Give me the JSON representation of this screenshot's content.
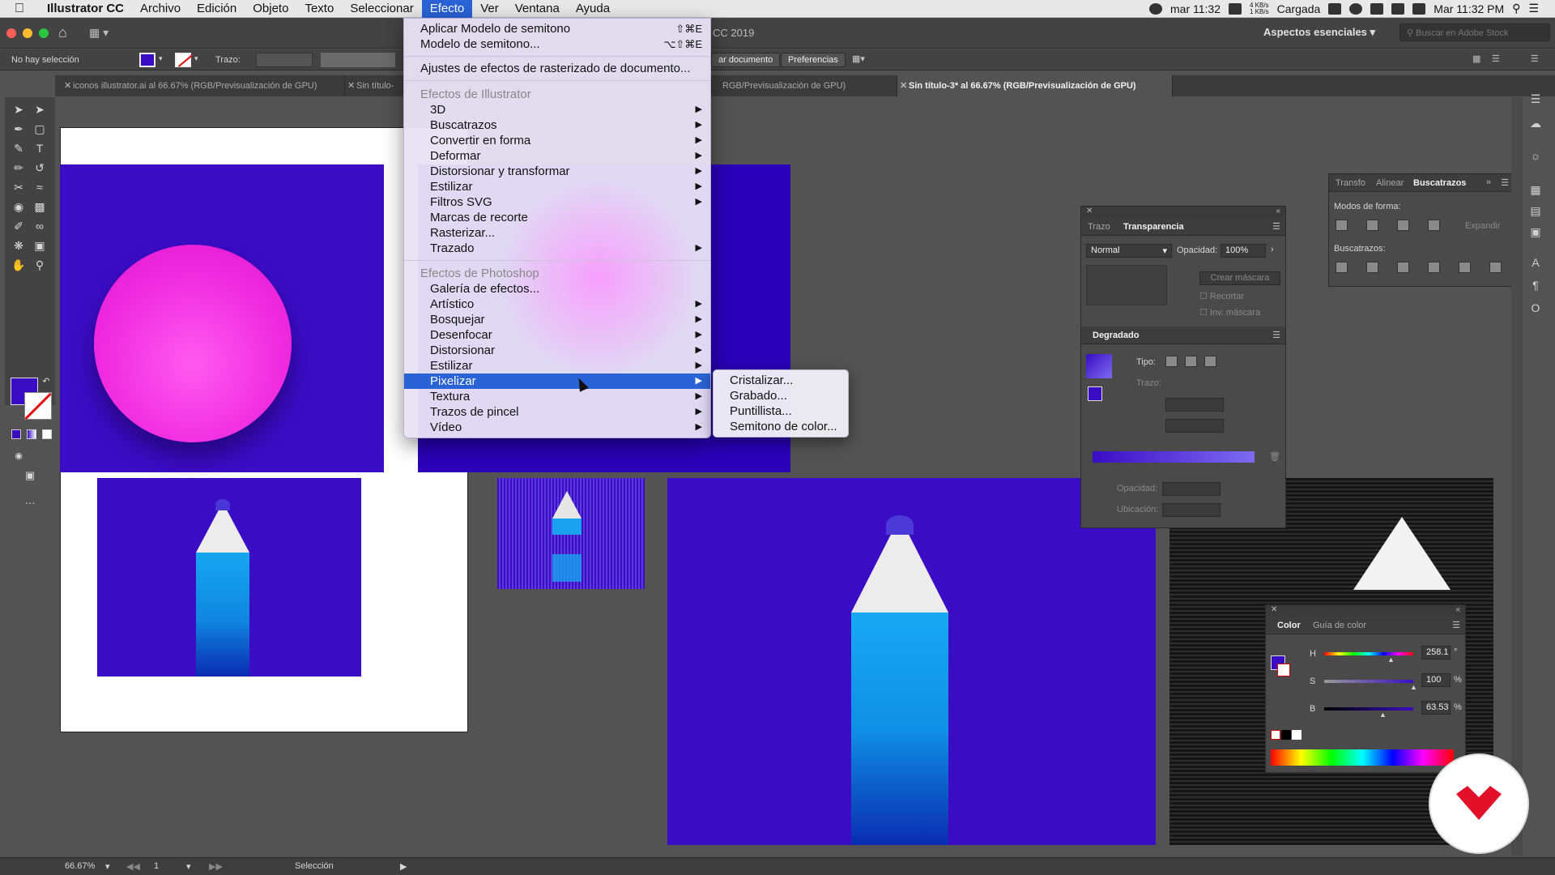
{
  "mac_menubar": {
    "app_name": "Illustrator CC",
    "menus": [
      "Archivo",
      "Edición",
      "Objeto",
      "Texto",
      "Seleccionar",
      "Efecto",
      "Ver",
      "Ventana",
      "Ayuda"
    ],
    "active_menu": "Efecto",
    "clock_short": "mar 11:32",
    "net_speed_up": "4 KB/s",
    "net_speed_down": "1 KB/s",
    "battery_label": "Cargada",
    "clock_full": "Mar 11:32 PM"
  },
  "app_bar": {
    "title_fragment": "CC 2019",
    "workspace": "Aspectos esenciales",
    "stock_search_placeholder": "Buscar en Adobe Stock"
  },
  "control_bar": {
    "selection_label": "No hay selección",
    "stroke_label": "Trazo:",
    "doc_button": "ar documento",
    "prefs_button": "Preferencias"
  },
  "tabs": [
    {
      "label": "iconos illustrator.ai al 66.67% (RGB/Previsualización de GPU)",
      "active": false
    },
    {
      "label": "Sin título-",
      "active": false
    },
    {
      "label": "RGB/Previsualización de GPU)",
      "active": false
    },
    {
      "label": "Sin título-3* al 66.67% (RGB/Previsualización de GPU)",
      "active": true
    }
  ],
  "effect_menu": {
    "top_items": [
      {
        "label": "Aplicar Modelo de semitono",
        "shortcut": "⇧⌘E"
      },
      {
        "label": "Modelo de semitono...",
        "shortcut": "⌥⇧⌘E"
      }
    ],
    "raster_settings": "Ajustes de efectos de rasterizado de documento...",
    "illustrator_header": "Efectos de Illustrator",
    "illustrator_items": [
      {
        "label": "3D",
        "submenu": true
      },
      {
        "label": "Buscatrazos",
        "submenu": true
      },
      {
        "label": "Convertir en forma",
        "submenu": true
      },
      {
        "label": "Deformar",
        "submenu": true
      },
      {
        "label": "Distorsionar y transformar",
        "submenu": true
      },
      {
        "label": "Estilizar",
        "submenu": true
      },
      {
        "label": "Filtros SVG",
        "submenu": true
      },
      {
        "label": "Marcas de recorte",
        "submenu": false
      },
      {
        "label": "Rasterizar...",
        "submenu": false
      },
      {
        "label": "Trazado",
        "submenu": true
      }
    ],
    "photoshop_header": "Efectos de Photoshop",
    "photoshop_items": [
      {
        "label": "Galería de efectos...",
        "submenu": false
      },
      {
        "label": "Artístico",
        "submenu": true
      },
      {
        "label": "Bosquejar",
        "submenu": true
      },
      {
        "label": "Desenfocar",
        "submenu": true
      },
      {
        "label": "Distorsionar",
        "submenu": true
      },
      {
        "label": "Estilizar",
        "submenu": true
      },
      {
        "label": "Pixelizar",
        "submenu": true
      },
      {
        "label": "Textura",
        "submenu": true
      },
      {
        "label": "Trazos de pincel",
        "submenu": true
      },
      {
        "label": "Vídeo",
        "submenu": true
      }
    ],
    "highlighted": "Pixelizar"
  },
  "pixelizar_submenu": [
    "Cristalizar...",
    "Grabado...",
    "Puntillista...",
    "Semitono de color..."
  ],
  "transparency_panel": {
    "tabs": [
      "Trazo",
      "Transparencia"
    ],
    "blend_mode": "Normal",
    "opacity_label": "Opacidad:",
    "opacity_value": "100%",
    "mask_button": "Crear máscara",
    "clip_label": "Recortar",
    "invert_label": "Inv. máscara"
  },
  "gradient_panel": {
    "title": "Degradado",
    "type_label": "Tipo:",
    "stroke_label": "Trazo:",
    "opacity_label": "Opacidad:",
    "location_label": "Ubicación:"
  },
  "pathfinder_panel": {
    "tabs": [
      "Transfo",
      "Alinear",
      "Buscatrazos"
    ],
    "shape_modes_label": "Modos de forma:",
    "expand_button": "Expandir",
    "pathfinders_label": "Buscatrazos:"
  },
  "color_panel": {
    "tabs": [
      "Color",
      "Guía de color"
    ],
    "channels": [
      {
        "name": "H",
        "value": "258.1",
        "unit": "°",
        "level": 0.72
      },
      {
        "name": "S",
        "value": "100",
        "unit": "%",
        "level": 1.0
      },
      {
        "name": "B",
        "value": "63.53",
        "unit": "%",
        "level": 0.64
      }
    ]
  },
  "status_bar": {
    "zoom": "66.67%",
    "artboard_number": "1",
    "tool_name": "Selección"
  },
  "colors": {
    "artwork_blue": "#3a0cc4",
    "sphere_pink": "#f02ee0",
    "pencil_cyan": "#19a8f5",
    "menu_highlight": "#2a63d6"
  }
}
